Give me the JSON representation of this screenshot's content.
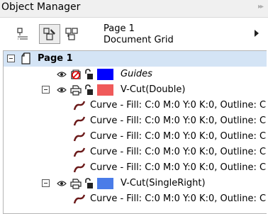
{
  "panel": {
    "title": "Object Manager",
    "expand_glyph": "▸▸"
  },
  "toolbar": {
    "page_name": "Page 1",
    "page_subtitle": "Document Grid",
    "buttons": [
      {
        "icon": "show-properties-icon"
      },
      {
        "icon": "show-object-properties-icon",
        "active": true
      },
      {
        "icon": "layer-manager-view-icon"
      }
    ]
  },
  "tree": {
    "page": {
      "label": "Page 1"
    },
    "layers": [
      {
        "label": "Guides",
        "color": "#0000ff",
        "italic": true,
        "icon": "guides-layer-icon"
      },
      {
        "label": "V-Cut(Double)",
        "color": "#f05a5a",
        "icon": "printable-layer-icon"
      },
      {
        "label": "V-Cut(SingleRight)",
        "color": "#4a7ce8",
        "icon": "printable-layer-icon"
      }
    ],
    "curves_double": [
      "Curve - Fill: C:0 M:0 Y:0 K:0, Outline: C",
      "Curve - Fill: C:0 M:0 Y:0 K:0, Outline: C",
      "Curve - Fill: C:0 M:0 Y:0 K:0, Outline: C",
      "Curve - Fill: C:0 M:0 Y:0 K:0, Outline: C",
      "Curve - Fill: C:0 M:0 Y:0 K:0, Outline: C"
    ],
    "curves_single_right": [
      "Curve - Fill: C:0 M:0 Y:0 K:0, Outline: C"
    ]
  }
}
